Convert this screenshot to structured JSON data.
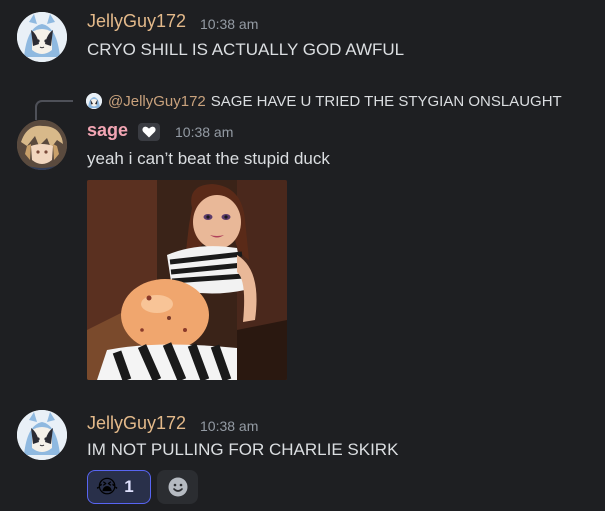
{
  "messages": [
    {
      "author": "JellyGuy172",
      "time": "10:38 am",
      "text": "CRYO SHILL IS ACTUALLY GOD AWFUL",
      "author_color": "#e3b98a"
    },
    {
      "reply_mention": "@JellyGuy172",
      "reply_text": "SAGE HAVE U TRIED THE STYGIAN ONSLAUGHT",
      "author": "sage",
      "time": "10:38 am",
      "text": "yeah i can’t beat the stupid duck",
      "author_color": "#f2a5b3",
      "badge_icon": "heart-icon",
      "attachment_icon": "doll-photo"
    },
    {
      "author": "JellyGuy172",
      "time": "10:38 am",
      "text": "IM NOT PULLING FOR CHARLIE SKIRK",
      "author_color": "#e3b98a",
      "reactions": [
        {
          "emoji": "😭",
          "count": "1"
        }
      ],
      "add_reaction_icon": "smiley-icon"
    }
  ]
}
